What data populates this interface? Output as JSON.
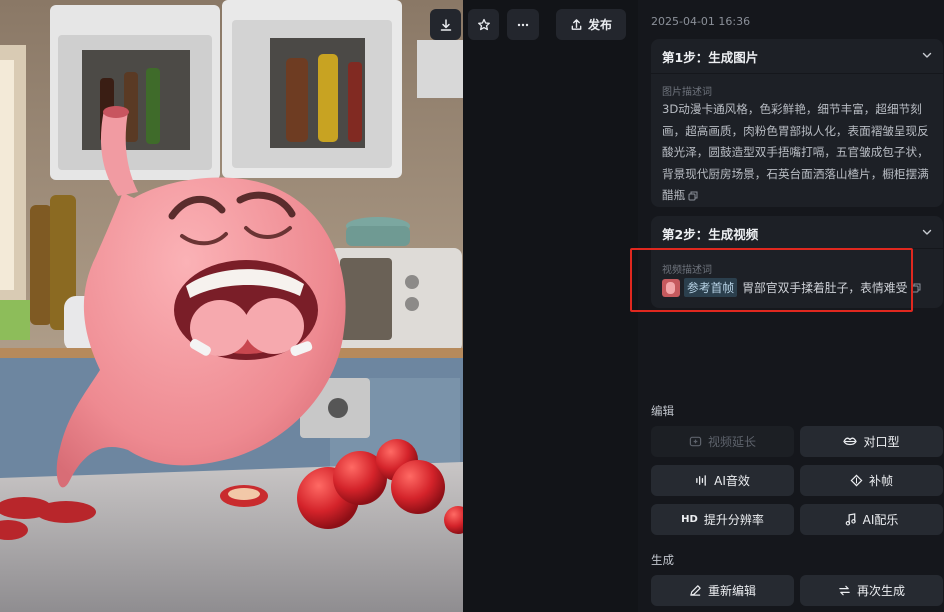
{
  "toolbar": {
    "download_icon": "download-icon",
    "star_icon": "star-icon",
    "more_icon": "more-horizontal-icon",
    "publish_label": "发布",
    "publish_icon": "upload-icon"
  },
  "panel": {
    "timestamp": "2025-04-01 16:36",
    "step1": {
      "title": "第1步：生成图片",
      "sub_label": "图片描述词",
      "prompt": "3D动漫卡通风格，色彩鲜艳，细节丰富，超细节刻画，超高画质，肉粉色胃部拟人化，表面褶皱呈现反酸光泽，圆鼓造型双手捂嘴打嗝，五官皱成包子状，背景现代厨房场景，石英台面洒落山楂片，橱柜摆满醋瓶"
    },
    "step2": {
      "title": "第2步：生成视频",
      "sub_label": "视频描述词",
      "ref_tag": "参考首帧",
      "prompt": "胃部官双手揉着肚子，表情难受"
    },
    "edit": {
      "label": "编辑",
      "buttons": [
        {
          "label": "视频延长",
          "icon": "extend-video-icon",
          "disabled": true
        },
        {
          "label": "对口型",
          "icon": "lips-icon",
          "disabled": false
        },
        {
          "label": "AI音效",
          "icon": "audio-wave-icon",
          "disabled": false
        },
        {
          "label": "补帧",
          "icon": "frame-interpolation-icon",
          "disabled": false
        },
        {
          "label": "提升分辨率",
          "icon": "hd-icon",
          "disabled": false
        },
        {
          "label": "AI配乐",
          "icon": "music-note-icon",
          "disabled": false
        }
      ]
    },
    "generate": {
      "label": "生成",
      "buttons": [
        {
          "label": "重新编辑",
          "icon": "pencil-icon"
        },
        {
          "label": "再次生成",
          "icon": "regenerate-icon"
        }
      ]
    }
  },
  "colors": {
    "panel_bg": "#15171c",
    "card_bg": "#1d2026",
    "button_bg": "#262a31",
    "highlight_border": "#e0281f",
    "character_pink": "#f08f95"
  }
}
